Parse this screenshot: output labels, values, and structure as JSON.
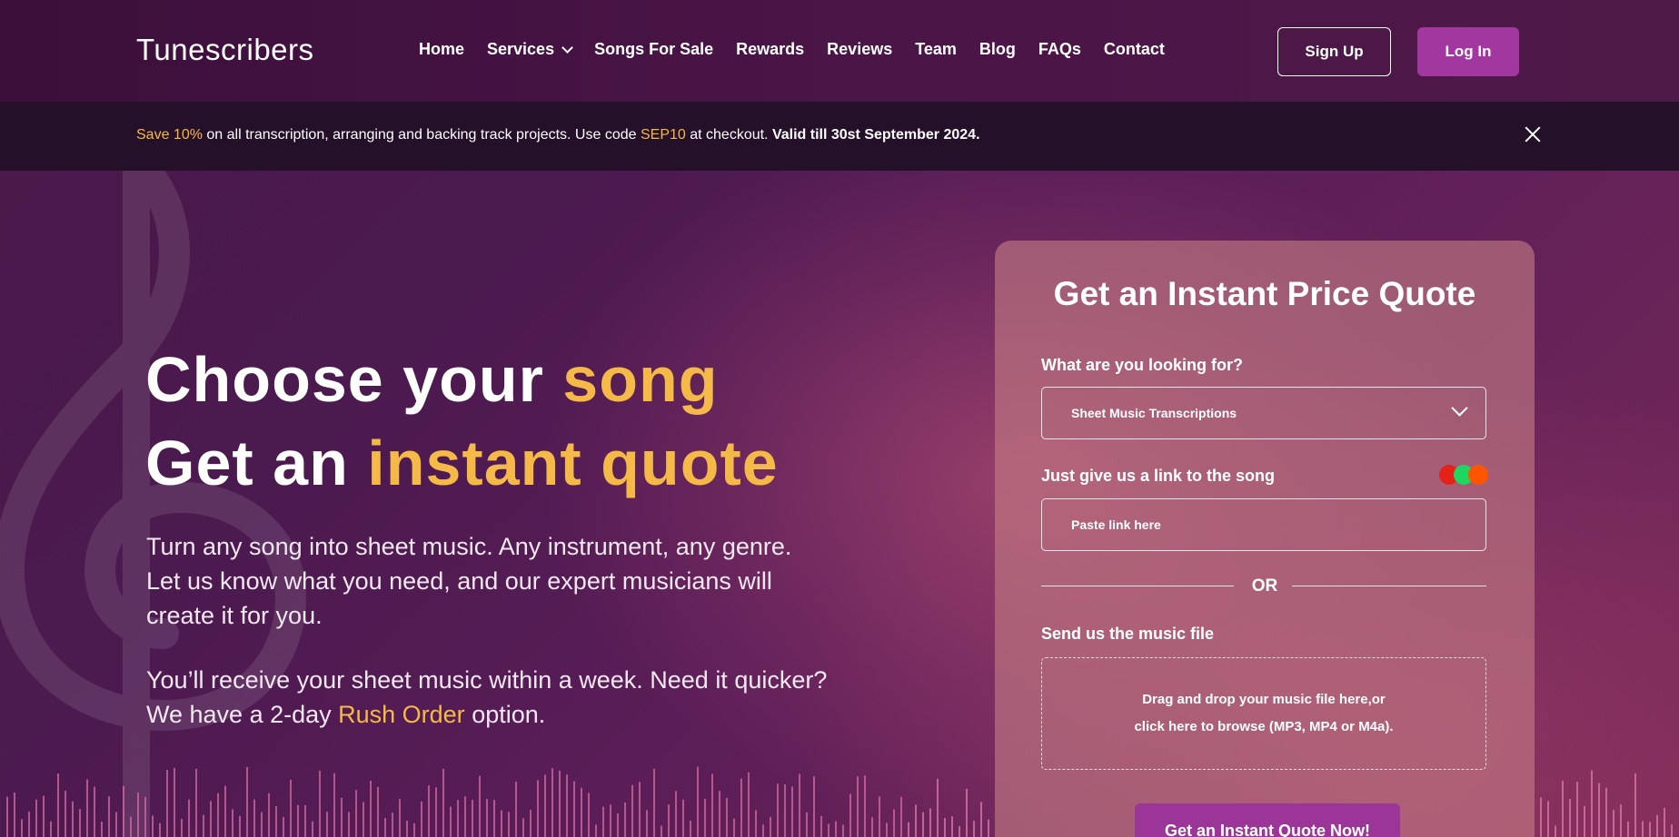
{
  "nav": {
    "logo": "Tunescribers",
    "items": [
      {
        "label": "Home"
      },
      {
        "label": "Services"
      },
      {
        "label": "Songs For Sale"
      },
      {
        "label": "Rewards"
      },
      {
        "label": "Reviews"
      },
      {
        "label": "Team"
      },
      {
        "label": "Blog"
      },
      {
        "label": "FAQs"
      },
      {
        "label": "Contact"
      }
    ],
    "signup_label": "Sign Up",
    "login_label": "Log In"
  },
  "promo": {
    "save": "Save 10%",
    "text1": " on all transcription, arranging and backing track projects. Use code ",
    "code": "SEP10",
    "text2": " at checkout. ",
    "valid": "Valid till 30st September 2024."
  },
  "hero": {
    "line1_a": "Choose your ",
    "line1_b": "song",
    "line2_a": "Get an ",
    "line2_b": "instant quote",
    "p1": "Turn any song into sheet music. Any instrument, any genre. Let us know what you need, and our expert musicians will create it for you.",
    "p2_a": "You’ll receive your sheet music within a week. Need it quicker? We have a 2-day ",
    "p2_link": "Rush Order",
    "p2_b": " option."
  },
  "quote": {
    "title": "Get an Instant Price Quote",
    "looking_label": "What are you looking for?",
    "looking_value": "Sheet Music Transcriptions",
    "link_label": "Just give us a link to the song",
    "link_placeholder": "Paste link here",
    "or": "OR",
    "file_label": "Send us the music file",
    "drop_line1": "Drag and drop your music file here,or",
    "drop_line2": "click here to browse (MP3, MP4 or M4a).",
    "button": "Get an Instant Quote Now!"
  },
  "colors": {
    "accent": "#f5b947",
    "brand": "#a2379f",
    "youtube": "#e62117",
    "spotify": "#1ed760",
    "soundcloud": "#ff5500"
  }
}
